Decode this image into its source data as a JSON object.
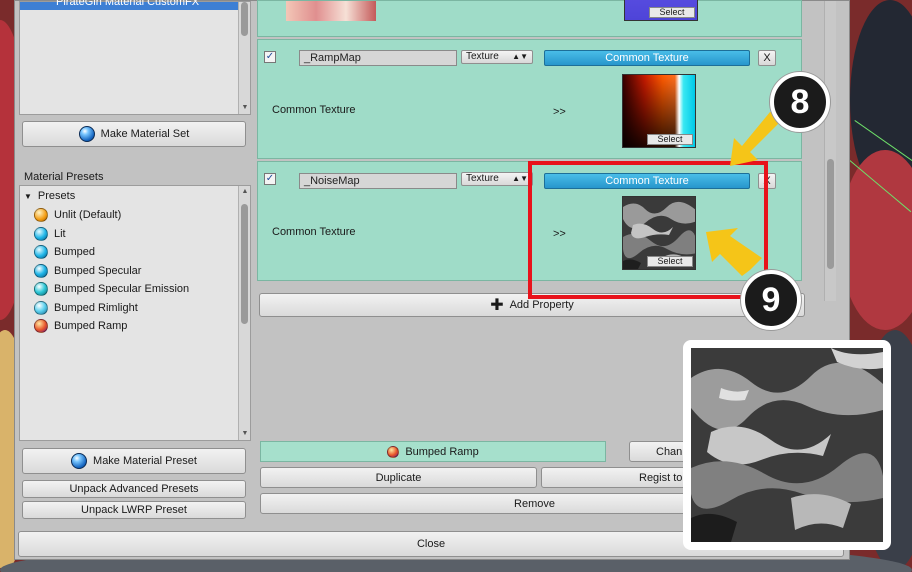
{
  "left_panel": {
    "material_list_item": "PirateGirl Material CustomFX",
    "make_material_set_label": "Make Material Set",
    "presets_section_title": "Material Presets",
    "presets_group_label": "Presets",
    "presets": [
      {
        "label": "Unlit (Default)",
        "color": "#f39c12"
      },
      {
        "label": "Lit",
        "color": "#1fb6e8"
      },
      {
        "label": "Bumped",
        "color": "#1fb6e8"
      },
      {
        "label": "Bumped Specular",
        "color": "#1fb6e8"
      },
      {
        "label": "Bumped Specular Emission",
        "color": "#2ec8d8"
      },
      {
        "label": "Bumped Rimlight",
        "color": "#5ad0ee"
      },
      {
        "label": "Bumped Ramp",
        "color": "#e8552a"
      }
    ],
    "make_material_preset_label": "Make Material Preset",
    "unpack_advanced_label": "Unpack Advanced Presets",
    "unpack_lwrp_label": "Unpack LWRP Preset"
  },
  "properties": [
    {
      "name": "_RampMap",
      "type": "Texture",
      "source_button": "Common Texture",
      "close_label": "X",
      "description": "Common Texture",
      "arrow": ">>",
      "select_label": "Select"
    },
    {
      "name": "_NoiseMap",
      "type": "Texture",
      "source_button": "Common Texture",
      "close_label": "X",
      "description": "Common Texture",
      "arrow": ">>",
      "select_label": "Select"
    }
  ],
  "top_thumb_select": "Select",
  "add_property_label": "Add Property",
  "bottom": {
    "current_preset": "Bumped Ramp",
    "change_label": "Chan",
    "duplicate_label": "Duplicate",
    "regist_label": "Regist to",
    "remove_label": "Remove",
    "close_label": "Close"
  },
  "callouts": {
    "first": "8",
    "second": "9"
  },
  "colors": {
    "card_bg": "#9fdcc8",
    "accent_blue": "#2796cc",
    "highlight_red": "#e8121b",
    "callout_arrow": "#f5c518"
  }
}
